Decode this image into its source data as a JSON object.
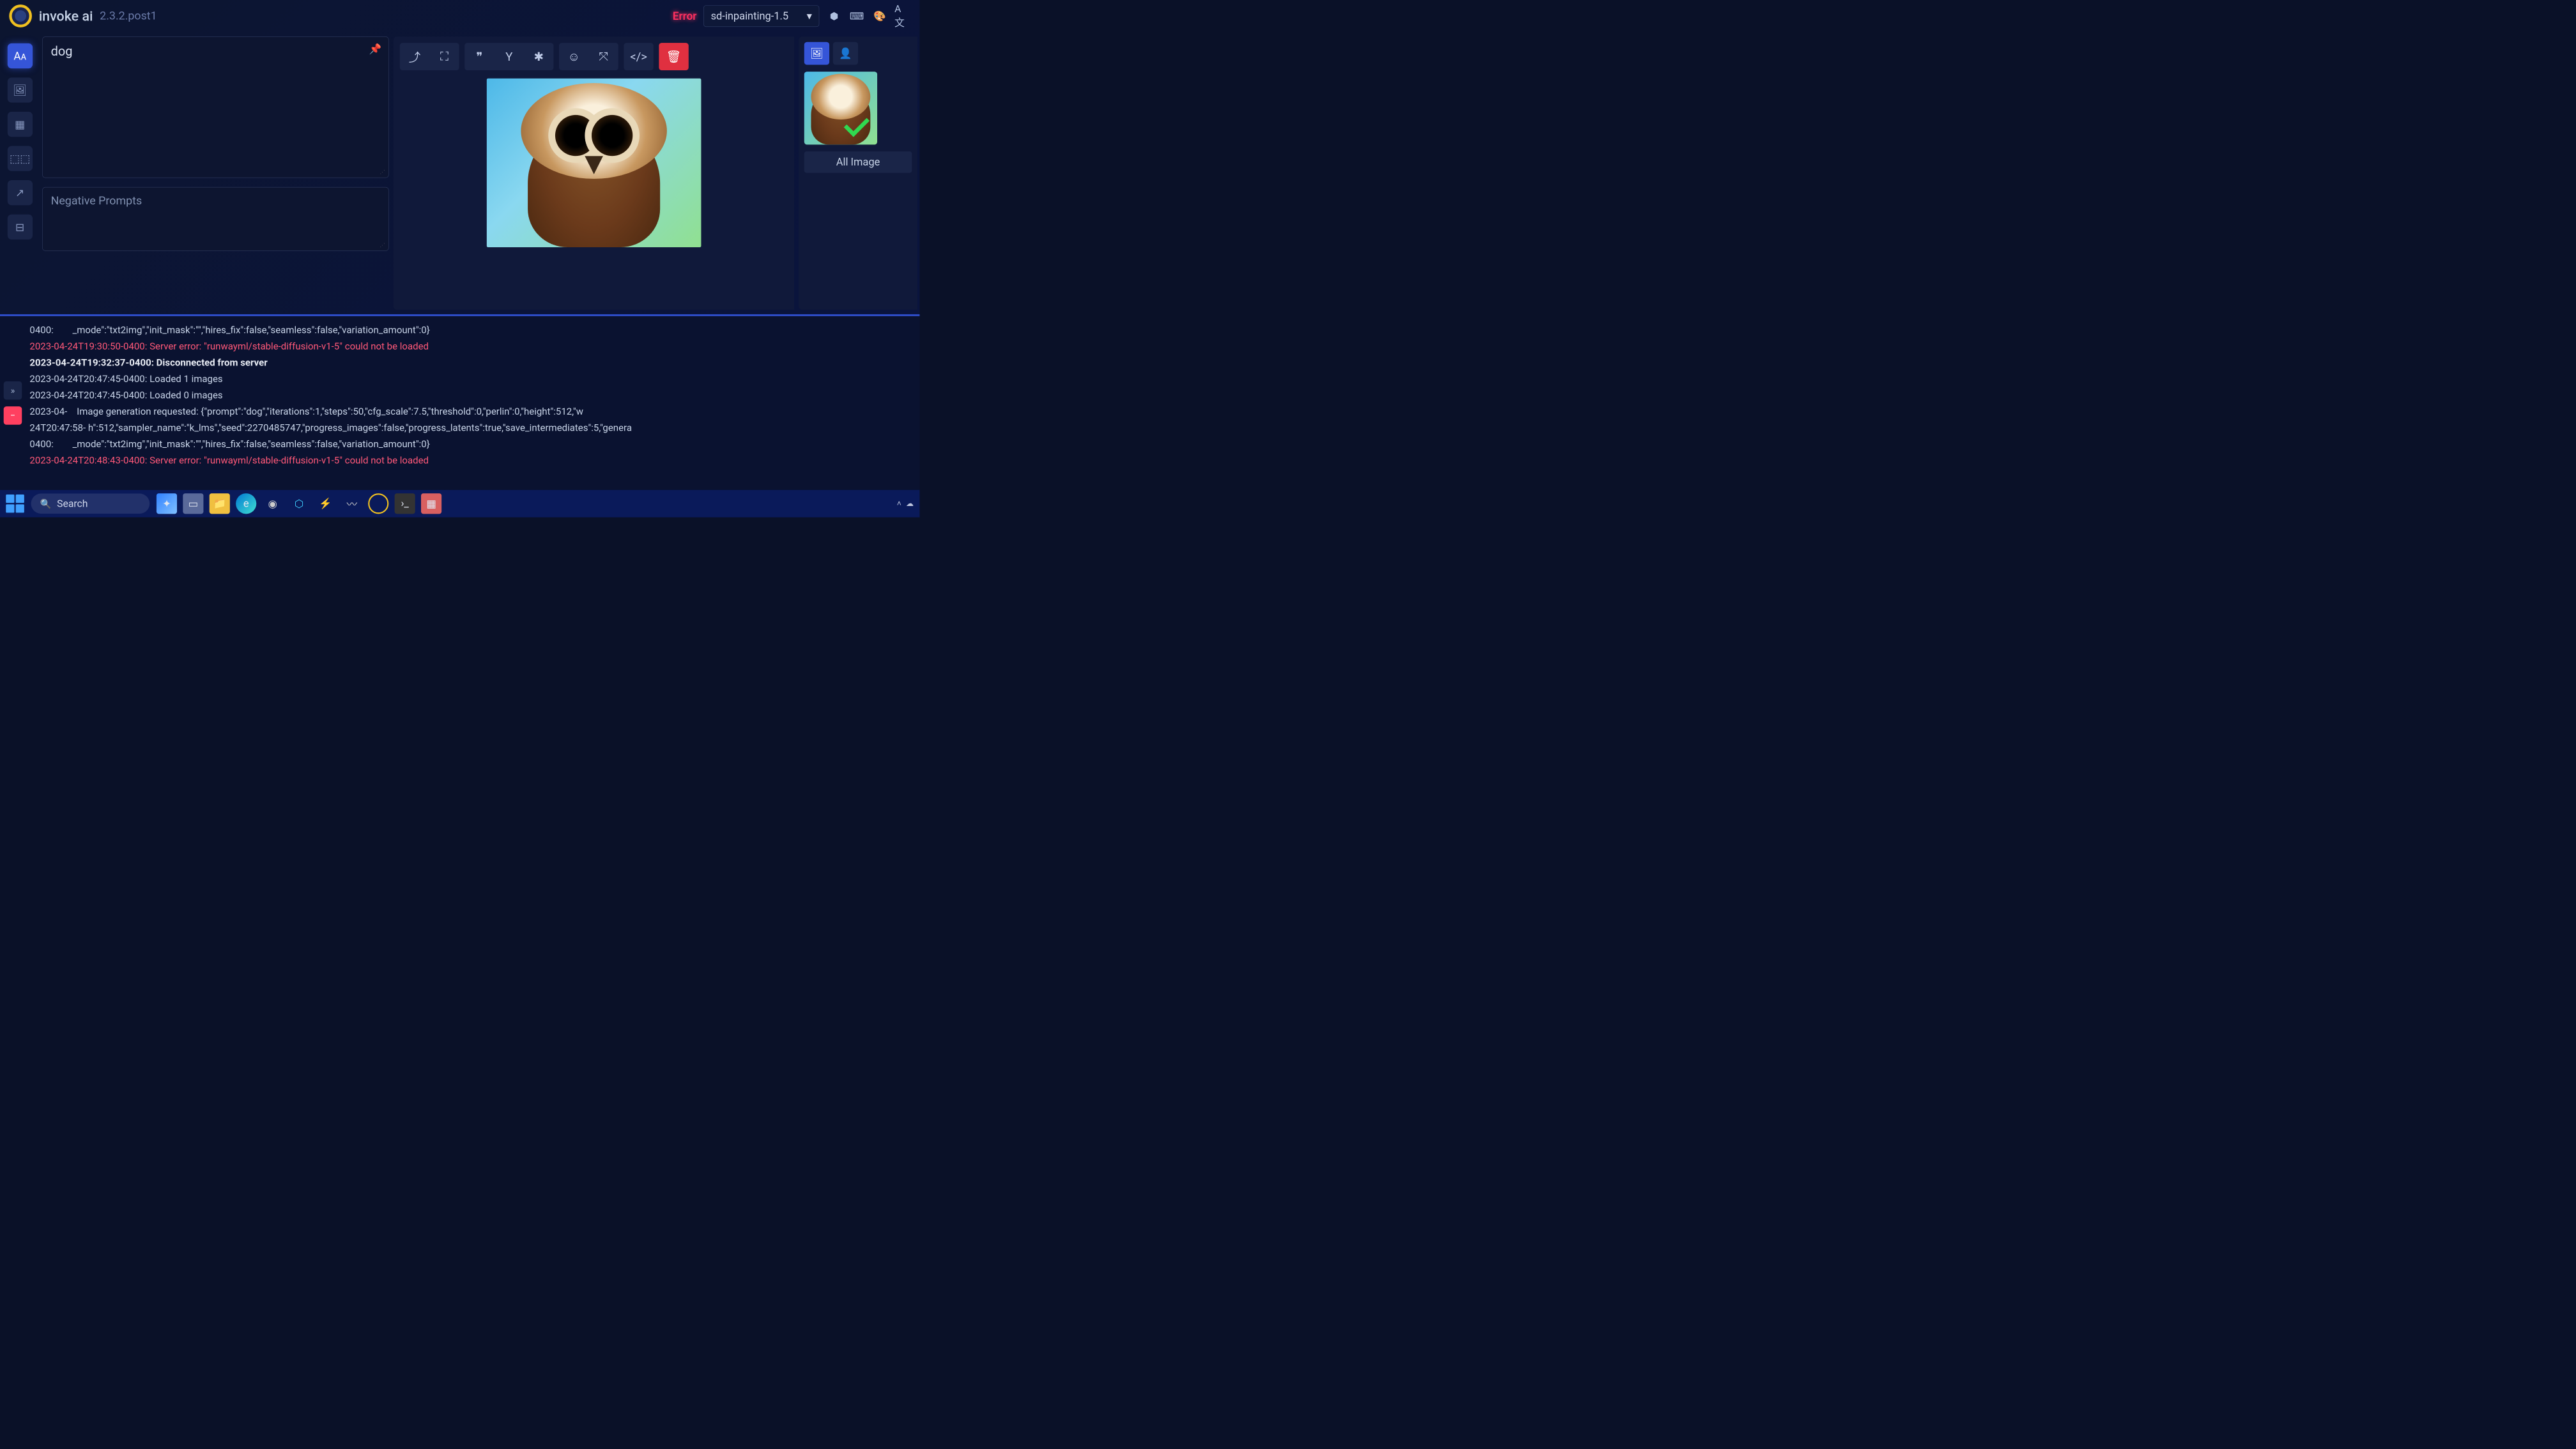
{
  "header": {
    "app_name": "invoke ai",
    "version": "2.3.2.post1",
    "error_label": "Error",
    "model_selected": "sd-inpainting-1.5"
  },
  "sidebar": {
    "items": [
      "txt2img",
      "img2img",
      "canvas",
      "nodes",
      "upscale",
      "training"
    ]
  },
  "prompts": {
    "positive": "dog",
    "negative_placeholder": "Negative Prompts"
  },
  "toolbar": {
    "groups": [
      [
        "share",
        "fullscreen"
      ],
      [
        "quote",
        "seed",
        "asterisk"
      ],
      [
        "emoji",
        "shuffle"
      ],
      [
        "code"
      ],
      [
        "delete"
      ]
    ]
  },
  "gallery": {
    "all_label": "All Image"
  },
  "console": {
    "lines": [
      {
        "cls": "",
        "text": "0400:        _mode\":\"txt2img\",\"init_mask\":\"\",\"hires_fix\":false,\"seamless\":false,\"variation_amount\":0}"
      },
      {
        "cls": "err",
        "text": "2023-04-24T19:30:50-0400: Server error: \"runwayml/stable-diffusion-v1-5\" could not be loaded"
      },
      {
        "cls": "bold",
        "text": "2023-04-24T19:32:37-0400: Disconnected from server"
      },
      {
        "cls": "",
        "text": "2023-04-24T20:47:45-0400: Loaded 1 images"
      },
      {
        "cls": "",
        "text": "2023-04-24T20:47:45-0400: Loaded 0 images"
      },
      {
        "cls": "",
        "text": "2023-04-    Image generation requested: {\"prompt\":\"dog\",\"iterations\":1,\"steps\":50,\"cfg_scale\":7.5,\"threshold\":0,\"perlin\":0,\"height\":512,\"w"
      },
      {
        "cls": "",
        "text": "24T20:47:58- h\":512,\"sampler_name\":\"k_lms\",\"seed\":2270485747,\"progress_images\":false,\"progress_latents\":true,\"save_intermediates\":5,\"genera"
      },
      {
        "cls": "",
        "text": "0400:        _mode\":\"txt2img\",\"init_mask\":\"\",\"hires_fix\":false,\"seamless\":false,\"variation_amount\":0}"
      },
      {
        "cls": "err",
        "text": "2023-04-24T20:48:43-0400: Server error: \"runwayml/stable-diffusion-v1-5\" could not be loaded"
      }
    ]
  },
  "taskbar": {
    "search_placeholder": "Search"
  }
}
